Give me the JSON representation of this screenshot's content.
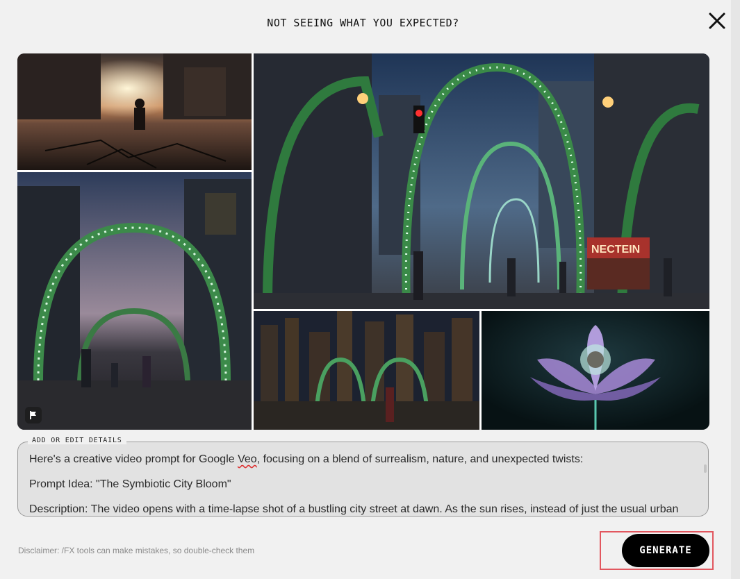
{
  "dialog": {
    "title": "NOT SEEING WHAT YOU EXPECTED?",
    "close_icon": "close-icon"
  },
  "images": [
    {
      "id": "tile-1",
      "description_icon": "image-thumbnail"
    },
    {
      "id": "tile-2",
      "description_icon": "image-thumbnail"
    },
    {
      "id": "tile-3",
      "description_icon": "image-thumbnail"
    },
    {
      "id": "tile-4",
      "description_icon": "image-thumbnail"
    },
    {
      "id": "tile-5",
      "description_icon": "image-thumbnail"
    }
  ],
  "details": {
    "label": "ADD OR EDIT DETAILS",
    "line1_before": "Here's a creative video prompt for Google ",
    "line1_word": "Veo",
    "line1_after": ", focusing on a blend of surrealism, nature, and unexpected twists:",
    "line2": "Prompt Idea: \"The Symbiotic City Bloom\"",
    "line3": "Description: The video opens with a time-lapse shot of a bustling city street at dawn. As the sun rises, instead of just the usual urban"
  },
  "footer": {
    "disclaimer": "Disclaimer: /FX tools can make mistakes, so double-check them",
    "generate_label": "GENERATE"
  },
  "colors": {
    "background": "#f1f1f1",
    "button": "#000000",
    "highlight": "#e2575f"
  }
}
